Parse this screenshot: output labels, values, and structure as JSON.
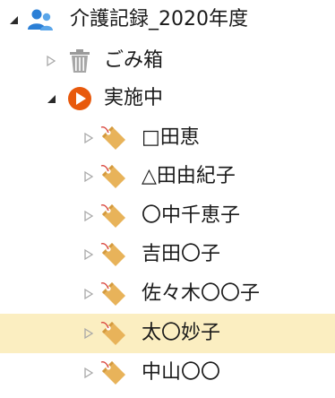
{
  "tree": {
    "root": {
      "label": "介護記録_2020年度",
      "icon": "users-icon",
      "expanded": true
    },
    "trash": {
      "label": "ごみ箱",
      "icon": "trash-icon",
      "expanded": false
    },
    "active": {
      "label": "実施中",
      "icon": "play-circle-icon",
      "expanded": true
    },
    "items": [
      {
        "label": "□田恵",
        "icon": "tag-icon"
      },
      {
        "label": "△田由紀子",
        "icon": "tag-icon"
      },
      {
        "label": "〇中千恵子",
        "icon": "tag-icon"
      },
      {
        "label": "吉田〇子",
        "icon": "tag-icon"
      },
      {
        "label": "佐々木〇〇子",
        "icon": "tag-icon"
      },
      {
        "label": "太〇妙子",
        "icon": "tag-icon",
        "selected": true
      },
      {
        "label": "中山〇〇",
        "icon": "tag-icon"
      }
    ]
  },
  "colors": {
    "selection": "#fbeec1",
    "users_icon": "#2b7fd6",
    "play_icon": "#e8590c",
    "tag_icon": "#e8b35a",
    "tag_pin": "#d9463e",
    "trash_icon": "#9a9a9a"
  }
}
